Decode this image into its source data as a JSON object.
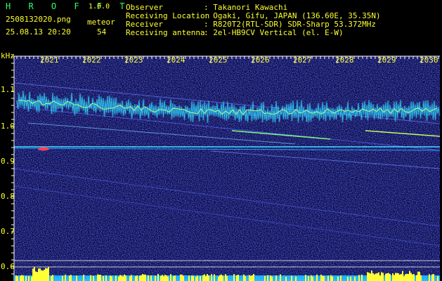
{
  "header": {
    "app_name": "H R O F F T",
    "version": "1.0.0",
    "filename": "2508132020.png",
    "datetime": "25.08.13 20:20",
    "meteor_label": "meteor",
    "meteor_count": "54"
  },
  "info": {
    "labels": [
      "Observer",
      "Receiving Location",
      "Receiver",
      "Receiving antenna"
    ],
    "values": [
      ": Takanori Kawachi",
      ": Ogaki, Gifu, JAPAN (136.60E, 35.35N)",
      ": R820T2(RTL-SDR) SDR-Sharp 53.372MHz",
      ": 2el-HB9CV Vertical (el. E-W)"
    ]
  },
  "axis": {
    "unit": "kHz",
    "y_ticks": [
      "1.1",
      "1.0",
      "0.9",
      "0.8",
      "0.7",
      "0.6"
    ],
    "x_ticks": [
      "2021",
      "2022",
      "2023",
      "2024",
      "2025",
      "2026",
      "2027",
      "2028",
      "2029",
      "2030"
    ]
  },
  "colors": {
    "label_green": "#33ff66",
    "label_yellow": "#ffff33",
    "background_blue": "#0a0a4a"
  }
}
